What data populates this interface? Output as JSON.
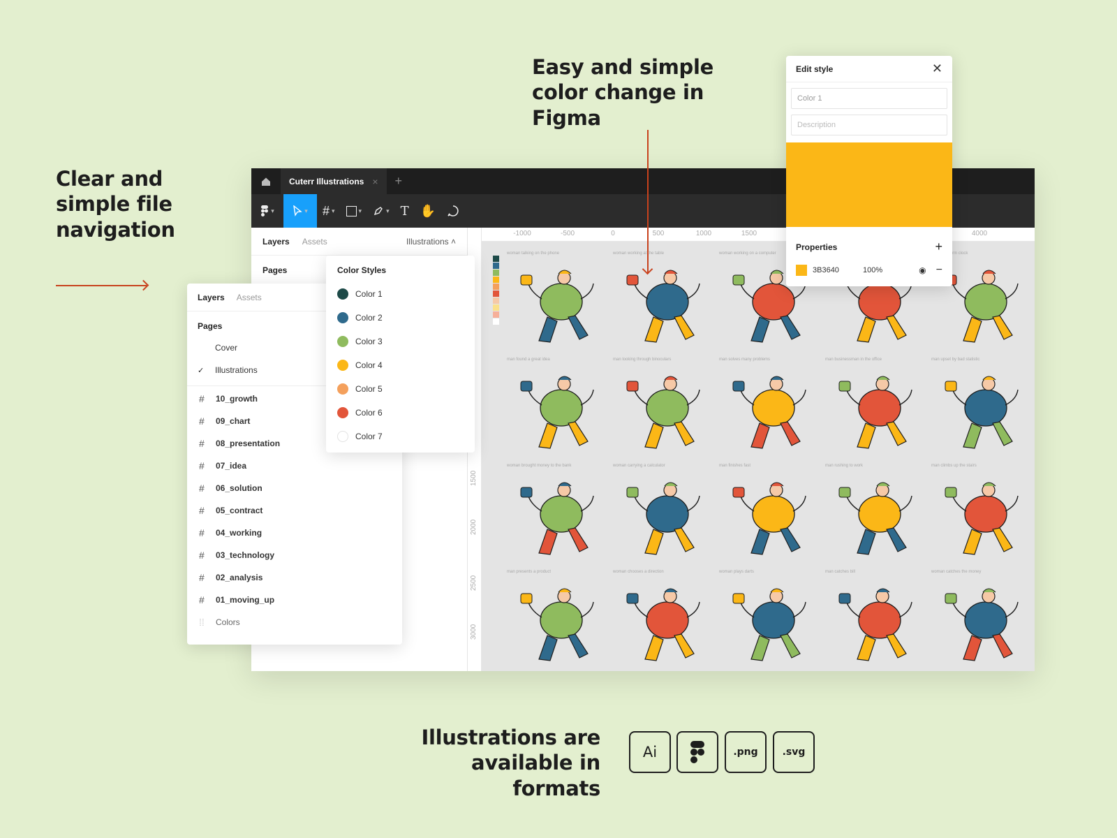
{
  "headlines": {
    "left": "Clear and simple file navigation",
    "top": "Easy and simple color change in Figma",
    "bottom": "Illustrations are available in formats"
  },
  "figma": {
    "file_tab": "Cuterr Illustrations",
    "panel_tabs": {
      "layers": "Layers",
      "assets": "Assets"
    },
    "page_select": "Illustrations",
    "pages_title": "Pages",
    "ruler_top": [
      "-1000",
      "-500",
      "0",
      "500",
      "1000",
      "1500",
      "4000"
    ],
    "ruler_left": [
      "1500",
      "2000",
      "2500",
      "3000",
      "3500"
    ]
  },
  "layers_panel": {
    "tabs": {
      "layers": "Layers",
      "assets": "Assets"
    },
    "pages_title": "Pages",
    "pages": [
      {
        "label": "Cover",
        "checked": ""
      },
      {
        "label": "Illustrations",
        "checked": "✓"
      }
    ],
    "frames": [
      "10_growth",
      "09_chart",
      "08_presentation",
      "07_idea",
      "06_solution",
      "05_contract",
      "04_working",
      "03_technology",
      "02_analysis",
      "01_moving_up"
    ],
    "colors_frame": "Colors"
  },
  "color_styles": {
    "title": "Color Styles",
    "items": [
      {
        "label": "Color 1",
        "color": "#1d4a48"
      },
      {
        "label": "Color 2",
        "color": "#2f6a8c"
      },
      {
        "label": "Color 3",
        "color": "#8fbb5e"
      },
      {
        "label": "Color 4",
        "color": "#fbb717"
      },
      {
        "label": "Color 5",
        "color": "#f4a05c"
      },
      {
        "label": "Color 6",
        "color": "#e2553a"
      },
      {
        "label": "Color 7",
        "color": "#ffffff"
      }
    ]
  },
  "edit_style": {
    "title": "Edit style",
    "name_value": "Color 1",
    "description_placeholder": "Description",
    "swatch_color": "#fbb717",
    "properties_title": "Properties",
    "hex": "3B3640",
    "opacity": "100%"
  },
  "canvas_captions": [
    "woman talking on the phone",
    "woman working at the table",
    "woman working on a computer",
    "",
    "after an alarm clock",
    "man found a great idea",
    "man looking through binoculars",
    "man solves many problems",
    "man businessman in the office",
    "man upset by bad statistic",
    "woman brought money to the bank",
    "woman carrying a calculator",
    "man finishes fast",
    "man rushing to work",
    "man climbs up the stairs",
    "man presents a product",
    "woman chooses a direction",
    "woman plays darts",
    "man catches bill",
    "woman catches the money"
  ],
  "formats": [
    "Ai",
    "",
    ".png",
    ".svg"
  ]
}
